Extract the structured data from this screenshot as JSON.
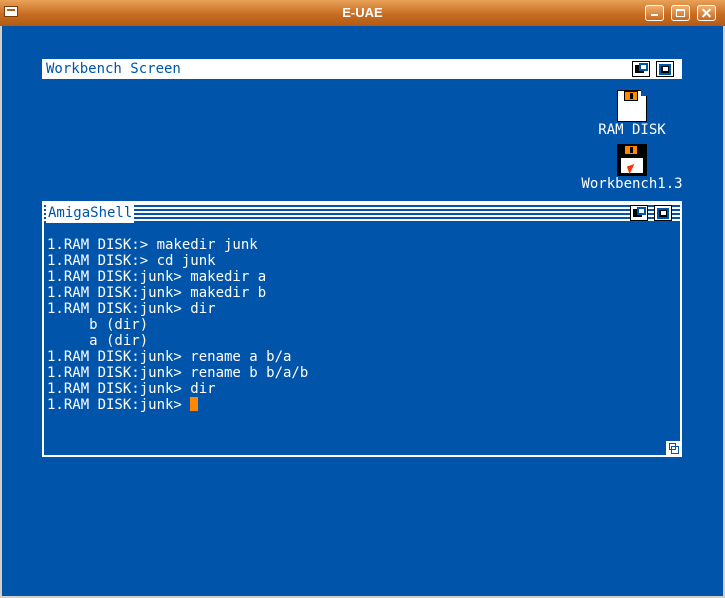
{
  "window": {
    "title": "E-UAE",
    "buttons": [
      "minimize",
      "maximize",
      "close"
    ]
  },
  "workbench": {
    "screen_title": "Workbench Screen"
  },
  "icons": [
    {
      "label": "RAM DISK",
      "icon": "ram-disk-icon"
    },
    {
      "label": "Workbench1.3",
      "icon": "floppy-disk-icon"
    }
  ],
  "shell": {
    "title": "AmigaShell",
    "lines": [
      "1.RAM DISK:> makedir junk",
      "1.RAM DISK:> cd junk",
      "1.RAM DISK:junk> makedir a",
      "1.RAM DISK:junk> makedir b",
      "1.RAM DISK:junk> dir",
      "     b (dir)",
      "     a (dir)",
      "1.RAM DISK:junk> rename a b/a",
      "1.RAM DISK:junk> rename b b/a/b",
      "1.RAM DISK:junk> dir"
    ],
    "prompt": "1.RAM DISK:junk> "
  },
  "colors": {
    "background": "#0055aa",
    "text": "#ffffff",
    "cursor": "#ff8800",
    "titlebar": "#c76d23"
  }
}
